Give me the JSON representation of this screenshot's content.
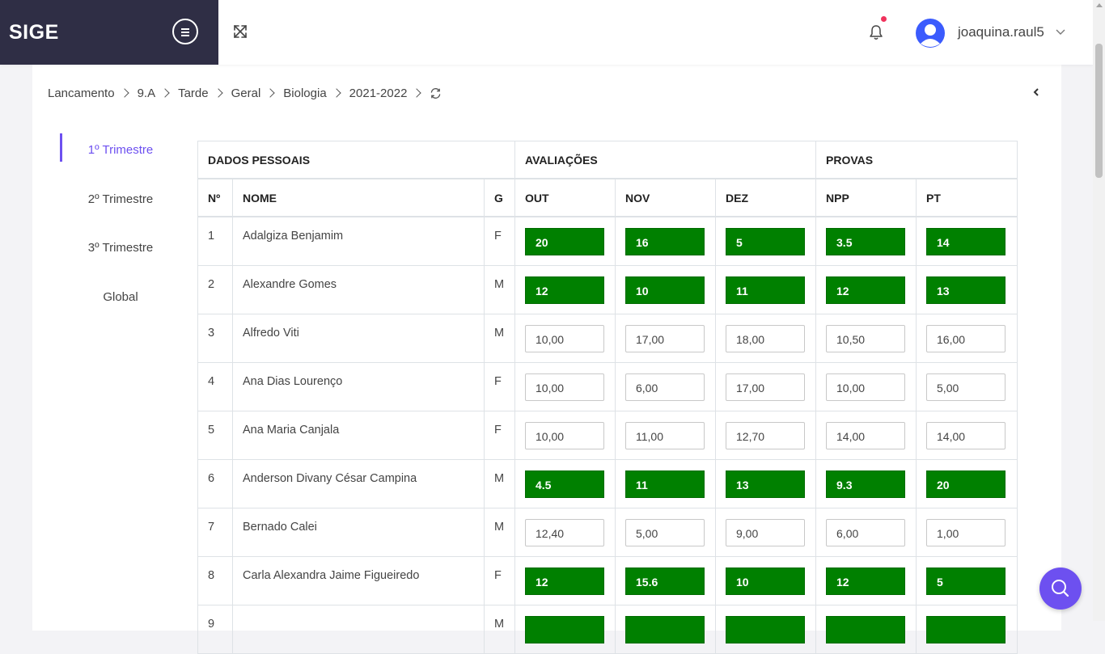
{
  "app": {
    "brand": "SIGE"
  },
  "user": {
    "name": "joaquina.raul5"
  },
  "breadcrumb": [
    "Lancamento",
    "9.A",
    "Tarde",
    "Geral",
    "Biologia",
    "2021-2022"
  ],
  "tabs": [
    {
      "label": "1º Trimestre",
      "active": true
    },
    {
      "label": "2º Trimestre",
      "active": false
    },
    {
      "label": "3º Trimestre",
      "active": false
    },
    {
      "label": "Global",
      "active": false
    }
  ],
  "table": {
    "groups": [
      "DADOS PESSOAIS",
      "AVALIAÇÕES",
      "PROVAS"
    ],
    "columns": [
      "Nº",
      "NOME",
      "G",
      "OUT",
      "NOV",
      "DEZ",
      "NPP",
      "PT"
    ],
    "rows": [
      {
        "n": "1",
        "name": "Adalgiza Benjamim",
        "g": "F",
        "mode": "done",
        "grades": [
          "20",
          "16",
          "5",
          "3.5",
          "14"
        ]
      },
      {
        "n": "2",
        "name": "Alexandre Gomes",
        "g": "M",
        "mode": "done",
        "grades": [
          "12",
          "10",
          "11",
          "12",
          "13"
        ]
      },
      {
        "n": "3",
        "name": "Alfredo Viti",
        "g": "M",
        "mode": "input",
        "grades": [
          "10,00",
          "17,00",
          "18,00",
          "10,50",
          "16,00"
        ]
      },
      {
        "n": "4",
        "name": "Ana Dias Lourenço",
        "g": "F",
        "mode": "input",
        "grades": [
          "10,00",
          "6,00",
          "17,00",
          "10,00",
          "5,00"
        ]
      },
      {
        "n": "5",
        "name": "Ana Maria Canjala",
        "g": "F",
        "mode": "input",
        "grades": [
          "10,00",
          "11,00",
          "12,70",
          "14,00",
          "14,00"
        ]
      },
      {
        "n": "6",
        "name": "Anderson Divany César Campina",
        "g": "M",
        "mode": "done",
        "grades": [
          "4.5",
          "11",
          "13",
          "9.3",
          "20"
        ]
      },
      {
        "n": "7",
        "name": "Bernado Calei",
        "g": "M",
        "mode": "input",
        "grades": [
          "12,40",
          "5,00",
          "9,00",
          "6,00",
          "1,00"
        ]
      },
      {
        "n": "8",
        "name": "Carla Alexandra Jaime Figueiredo",
        "g": "F",
        "mode": "done",
        "grades": [
          "12",
          "15.6",
          "10",
          "12",
          "5"
        ]
      },
      {
        "n": "9",
        "name": "",
        "g": "M",
        "mode": "done",
        "grades": [
          "",
          "",
          "",
          "",
          ""
        ]
      }
    ]
  },
  "colors": {
    "brand_bg": "#2f2e45",
    "accent": "#6d50f0",
    "grade_done": "#008000",
    "notification": "#f0325c"
  },
  "icons": [
    "menu-icon",
    "fullscreen-icon",
    "bell-icon",
    "user-avatar-icon",
    "chevron-down-icon",
    "refresh-icon",
    "chevron-left-icon",
    "search-icon"
  ]
}
